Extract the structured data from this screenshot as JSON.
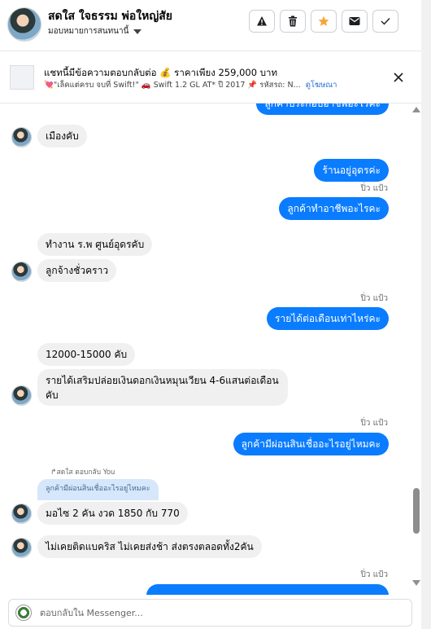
{
  "header": {
    "contact_name": "สดใส ใจธรรม พ่อใหญ่สัย",
    "assign_label": "มอบหมายการสนทนานี้",
    "actions": [
      {
        "icon": "warning-icon",
        "label": "Report"
      },
      {
        "icon": "trash-icon",
        "label": "Delete"
      },
      {
        "icon": "star-icon",
        "label": "Star"
      },
      {
        "icon": "mail-icon",
        "label": "Mark unread"
      },
      {
        "icon": "check-icon",
        "label": "Done"
      }
    ],
    "star_color": "#f7a53b"
  },
  "ad": {
    "title": "แชทนี้มีข้อความตอบกลับต่อ 💰 ราคาเพียง 259,000 บาท",
    "detail": "💘\"เล็คแต่ครบ จบที่ Swift!\" 🚗 Swift 1.2 GL AT* ปี 2017 📌 รหัสรถ: N...",
    "link": "ดูโฆษณา"
  },
  "messages": {
    "m0": "ลูกค้าประกอบอาชีพอะไรคะ",
    "m1": "เมืองคับ",
    "m2": "ร้านอยู่อุดรค่ะ",
    "sender1": "ปิ่ว แป้ว",
    "m3": "ลูกค้าทำอาชีพอะไรคะ",
    "m4": "ทำงาน ร.พ ศูนย์อุดรคับ",
    "m5": "ลูกจ้างชั่วคราว",
    "sender2": "ปิ่ว แป้ว",
    "m6": "รายได้ต่อเดือนเท่าไหร่คะ",
    "m7": "12000-15000 คับ",
    "m8a": "รายได้เสริมปล่อยเงินดอกเงินหมุนเวียน 4-6แสนต่อเดือน",
    "m8b": "คับ",
    "sender3": "ปิ่ว แป้ว",
    "m9": "ลูกค้ามีผ่อนสินเชื่ออะไรอยู่ไหมคะ",
    "reply_label": "สดใส ตอบกลับ You",
    "reply_quote": "ลูกค้ามีผ่อนสินเชื่ออะไรอยู่ไหมคะ",
    "m10": "มอไซ 2 คัน งวด 1850 กับ 770",
    "m11": "ไม่เคยติดแบคริส ไม่เคยส่งช้า ส่งตรงตลอดทั้ง2คัน",
    "sender4": "ปิ่ว แป้ว"
  },
  "composer": {
    "placeholder": "ตอบกลับใน Messenger..."
  },
  "colors": {
    "outgoing": "#0a7cff",
    "incoming": "#f0f0f0"
  }
}
